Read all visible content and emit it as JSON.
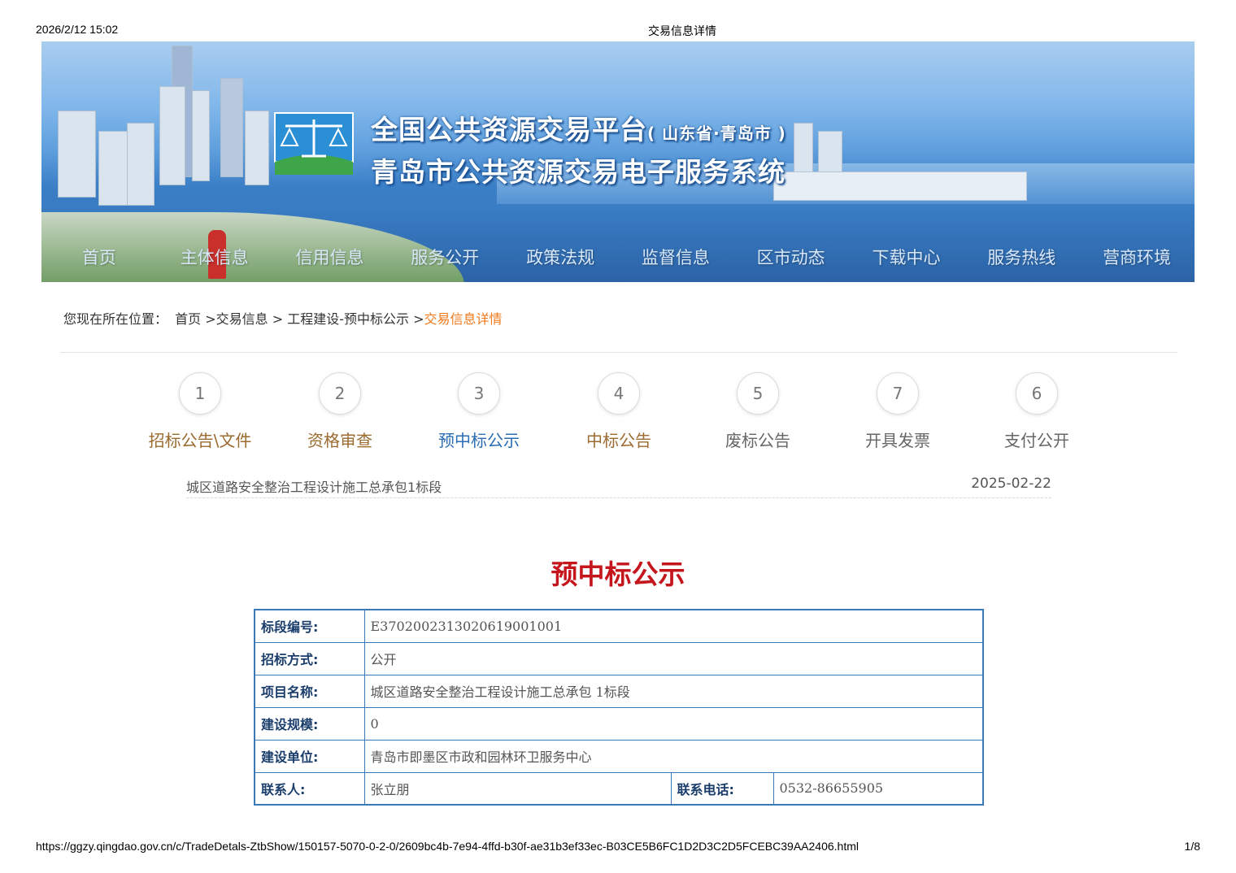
{
  "print": {
    "datetime": "2026/2/12 15:02",
    "doc_title": "交易信息详情",
    "url": "https://ggzy.qingdao.gov.cn/c/TradeDetals-ZtbShow/150157-5070-0-2-0/2609bc4b-7e94-4ffd-b30f-ae31b3ef33ec-B03CE5B6FC1D2D3C2D5FCEBC39AA2406.html",
    "page": "1/8"
  },
  "banner": {
    "title_main": "全国公共资源交易平台",
    "title_region": "( 山东省·青岛市 )",
    "subtitle": "青岛市公共资源交易电子服务系统",
    "nav": [
      "首页",
      "主体信息",
      "信用信息",
      "服务公开",
      "政策法规",
      "监督信息",
      "区市动态",
      "下载中心",
      "服务热线",
      "营商环境"
    ]
  },
  "breadcrumb": {
    "prefix": "您现在所在位置：",
    "items": [
      "首页",
      " >交易信息",
      " > 工程建设-预中标公示",
      " >"
    ],
    "current": "交易信息详情"
  },
  "steps": [
    {
      "num": "1",
      "label": "招标公告\\文件",
      "color": "#9a6a2f"
    },
    {
      "num": "2",
      "label": "资格审查",
      "color": "#9a6a2f"
    },
    {
      "num": "3",
      "label": "预中标公示",
      "color": "#2a6db5"
    },
    {
      "num": "4",
      "label": "中标公告",
      "color": "#9a6a2f"
    },
    {
      "num": "5",
      "label": "废标公告",
      "color": "#666666"
    },
    {
      "num": "7",
      "label": "开具发票",
      "color": "#666666"
    },
    {
      "num": "6",
      "label": "支付公开",
      "color": "#666666"
    }
  ],
  "record": {
    "project": "城区道路安全整治工程设计施工总承包1标段",
    "date": "2025-02-22"
  },
  "heading": "预中标公示",
  "info": {
    "section_no_label": "标段编号:",
    "section_no": "E3702002313020619001001",
    "method_label": "招标方式:",
    "method": "公开",
    "project_label": "项目名称:",
    "project": "城区道路安全整治工程设计施工总承包 1标段",
    "scale_label": "建设规模:",
    "scale": "0",
    "unit_label": "建设单位:",
    "unit": "青岛市即墨区市政和园林环卫服务中心",
    "contact_label": "联系人:",
    "contact": "张立朋",
    "phone_label": "联系电话:",
    "phone": "0532-86655905"
  },
  "colors": {
    "accent_orange": "#f07a1c",
    "heading_red": "#c4161c",
    "table_border": "#3a78b8",
    "label_blue": "#1a3d6b"
  }
}
